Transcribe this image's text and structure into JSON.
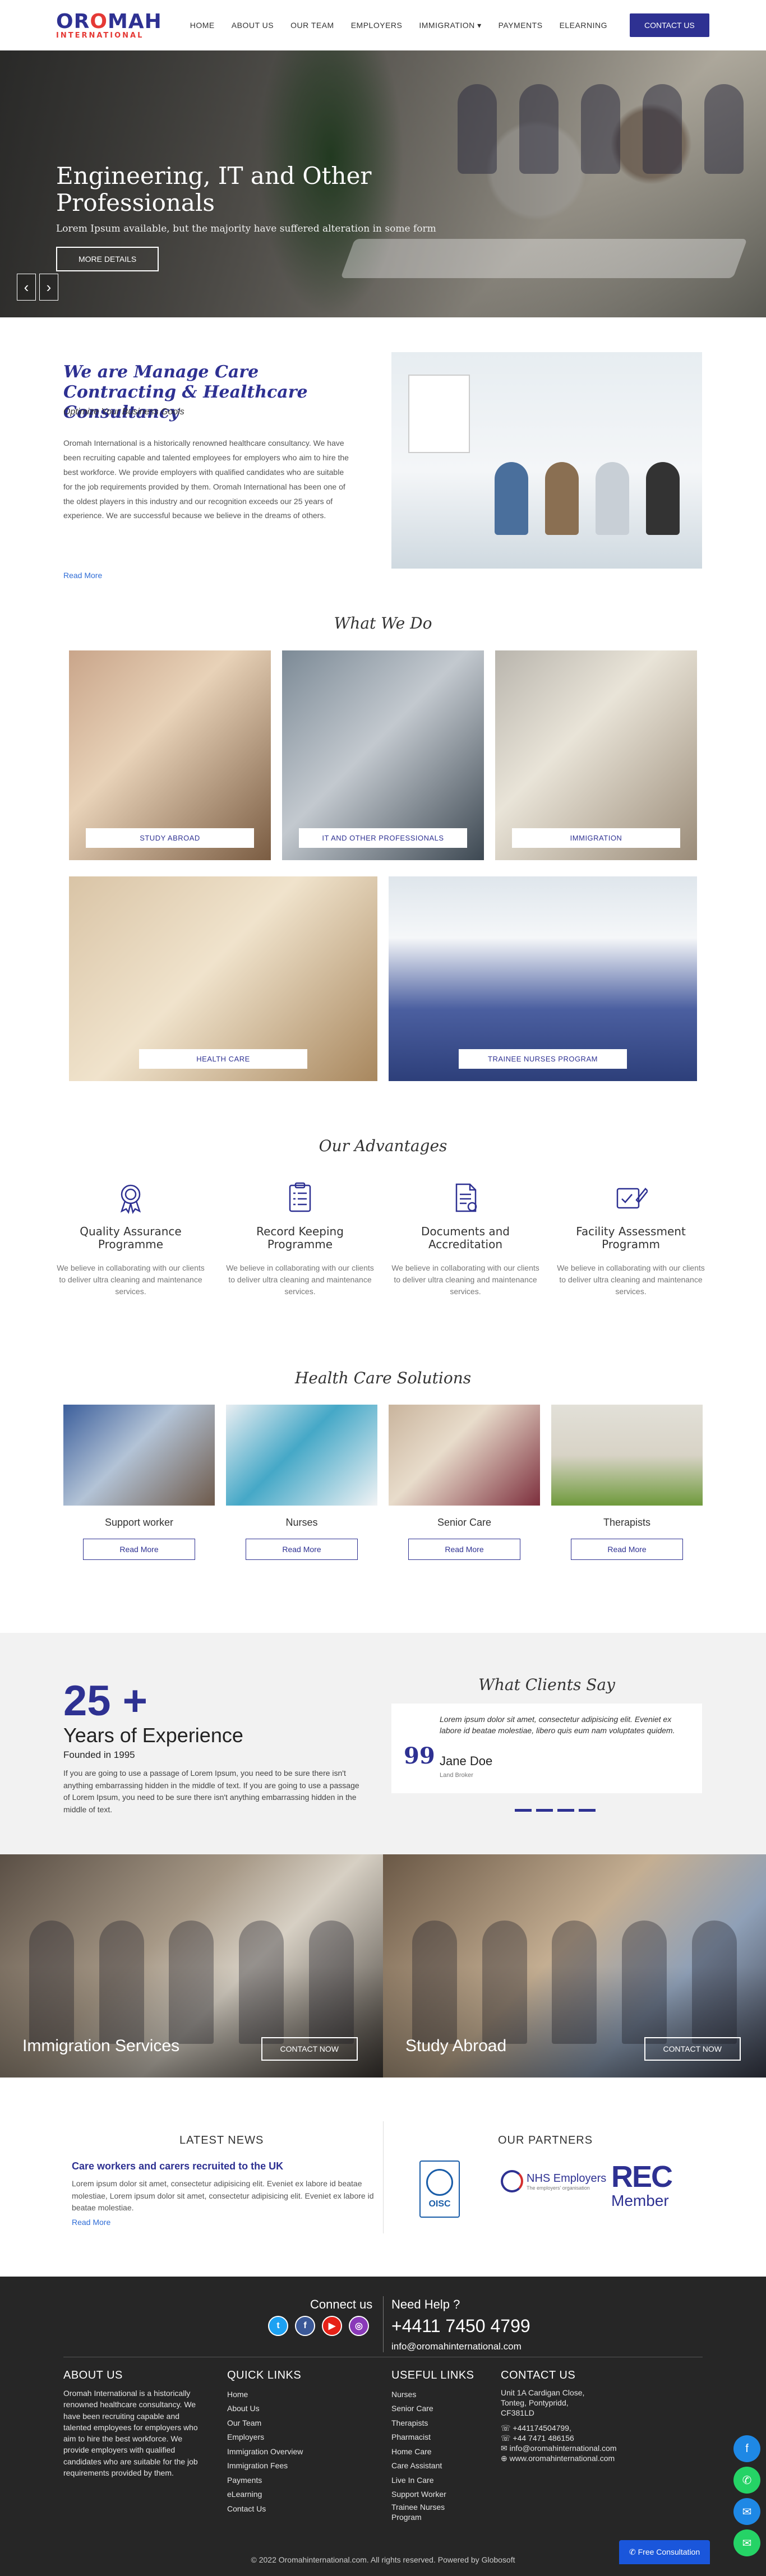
{
  "header": {
    "logo_main": "OR",
    "logo_flame": "O",
    "logo_rest": "MAH",
    "logo_sub": "INTERNATIONAL",
    "nav": [
      "HOME",
      "ABOUT US",
      "OUR TEAM",
      "EMPLOYERS",
      "IMMIGRATION ▾",
      "PAYMENTS",
      "ELEARNING"
    ],
    "cta": "CONTACT US"
  },
  "hero": {
    "title": "Engineering, IT and Other Professionals",
    "subtitle": "Lorem Ipsum available, but the majority have suffered alteration in some form",
    "button": "MORE DETAILS",
    "prev": "‹",
    "next": "›"
  },
  "about": {
    "title": "We are Manage Care Contracting & Healthcare Consultancy",
    "subtitle": "Optimize Your Business Gools",
    "text": "Oromah International is a historically renowned healthcare consultancy. We have been recruiting capable and talented employees for employers who aim to hire the best workforce. We provide employers with qualified candidates who are suitable for the job requirements provided by them. Oromah International has been one of the oldest players in this industry and our recognition exceeds our 25 years of experience. We are successful because we believe in the dreams of others.",
    "link": "Read More"
  },
  "what_we_do": {
    "title": "What We Do",
    "tiles": [
      "STUDY ABROAD",
      "IT AND OTHER PROFESSIONALS",
      "IMMIGRATION",
      "HEALTH CARE",
      "TRAINEE NURSES PROGRAM"
    ]
  },
  "advantages": {
    "title": "Our Advantages",
    "items": [
      {
        "title": "Quality Assurance Programme",
        "text": "We believe in collaborating with our clients to deliver ultra cleaning and maintenance services.",
        "icon": "award-icon"
      },
      {
        "title": "Record Keeping Programme",
        "text": "We believe in collaborating with our clients to deliver ultra cleaning and maintenance services.",
        "icon": "clipboard-icon"
      },
      {
        "title": "Documents and Accreditation",
        "text": "We believe in collaborating with our clients to deliver ultra cleaning and maintenance services.",
        "icon": "document-icon"
      },
      {
        "title": "Facility Assessment Programm",
        "text": "We believe in collaborating with our clients to deliver ultra cleaning and maintenance services.",
        "icon": "signature-icon"
      }
    ]
  },
  "health_care": {
    "title": "Health Care Solutions",
    "items": [
      {
        "title": "Support worker",
        "button": "Read More"
      },
      {
        "title": "Nurses",
        "button": "Read More"
      },
      {
        "title": "Senior Care",
        "button": "Read More"
      },
      {
        "title": "Therapists",
        "button": "Read More"
      }
    ]
  },
  "experience": {
    "number": "25 +",
    "heading": "Years of Experience",
    "founded": "Founded in 1995",
    "text": "If you are going to use a passage of Lorem Ipsum, you need to be sure there isn't anything embarrassing hidden in the middle of text. If you are going to use a passage of Lorem Ipsum, you need to be sure there isn't anything embarrassing hidden in the middle of text."
  },
  "clients": {
    "title": "What Clients Say",
    "quote": "Lorem ipsum dolor sit amet, consectetur adipisicing elit. Eveniet ex labore id beatae molestiae, libero quis eum nam voluptates quidem.",
    "name": "Jane Doe",
    "role": "Land Broker",
    "quote_mark": "99"
  },
  "banners": {
    "left_title": "Immigration Services",
    "left_button": "CONTACT NOW",
    "right_title": "Study Abroad",
    "right_button": "CONTACT NOW"
  },
  "news": {
    "heading": "LATEST NEWS",
    "title": "Care workers and carers recruited to the UK",
    "text": "Lorem ipsum dolor sit amet, consectetur adipisicing elit. Eveniet ex labore id beatae molestiae, Lorem ipsum dolor sit amet, consectetur adipisicing elit. Eveniet ex labore id beatae molestiae.",
    "link": "Read More"
  },
  "partners": {
    "heading": "OUR PARTNERS",
    "oisc": "OISC",
    "nhs": "NHS Employers",
    "nhs_sub": "The employers' organisation",
    "rec": "REC",
    "rec_member": "Member"
  },
  "footer": {
    "connect": "Connect us",
    "help": "Need Help ?",
    "phone": "+4411 7450 4799",
    "email": "info@oromahinternational.com",
    "social": [
      "t",
      "f",
      "▶",
      "◎"
    ],
    "about_h": "ABOUT US",
    "about_text": "Oromah International is a historically renowned healthcare consultancy. We have been recruiting capable and talented employees for employers who aim to hire the best workforce. We provide employers with qualified candidates who are suitable for the job requirements provided by them.",
    "quick_h": "QUICK LINKS",
    "quick": [
      "Home",
      "About Us",
      "Our Team",
      "Employers",
      "Immigration Overview",
      "Immigration Fees",
      "Payments",
      "eLearning",
      "Contact Us"
    ],
    "useful_h": "USEFUL LINKS",
    "useful": [
      "Nurses",
      "Senior Care",
      "Therapists",
      "Pharmacist",
      "Home Care",
      "Care Assistant",
      "Live In Care",
      "Support Worker",
      "Trainee Nurses Program"
    ],
    "contact_h": "CONTACT US",
    "contact": [
      "Unit 1A Cardigan Close,",
      "Tonteg, Pontypridd,",
      "CF381LD",
      "☏ +4411745047​99,",
      "☏ +44 7471 486156",
      "✉ info@oromahinternational.com",
      "⊕ www.oromahinternational.com"
    ],
    "copyright": "© 2022 Oromahinternational.com. All rights reserved. Powered by Globosoft",
    "free_consult": "✆ Free Consultation"
  }
}
